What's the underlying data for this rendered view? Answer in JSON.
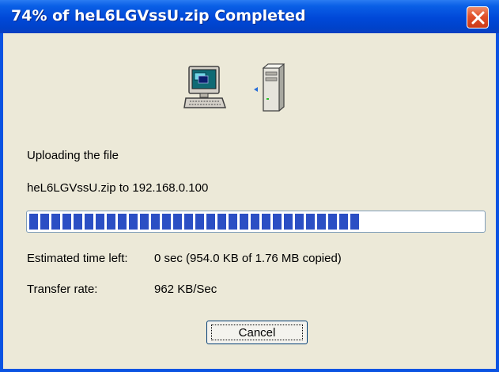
{
  "window": {
    "title": "74% of heL6LGVssU.zip Completed",
    "close_icon": "close-icon"
  },
  "icons": {
    "source": "computer-icon",
    "direction": "left-arrow-icon",
    "destination": "server-icon"
  },
  "status": {
    "action": "Uploading the file",
    "file_target": "heL6LGVssU.zip to 192.168.0.100"
  },
  "progress": {
    "percent": 74,
    "color": "#2b4fc4"
  },
  "details": {
    "time_label": "Estimated time left:",
    "time_value": "0 sec (954.0 KB of 1.76 MB copied)",
    "rate_label": "Transfer rate:",
    "rate_value": "962 KB/Sec"
  },
  "buttons": {
    "cancel": "Cancel"
  }
}
